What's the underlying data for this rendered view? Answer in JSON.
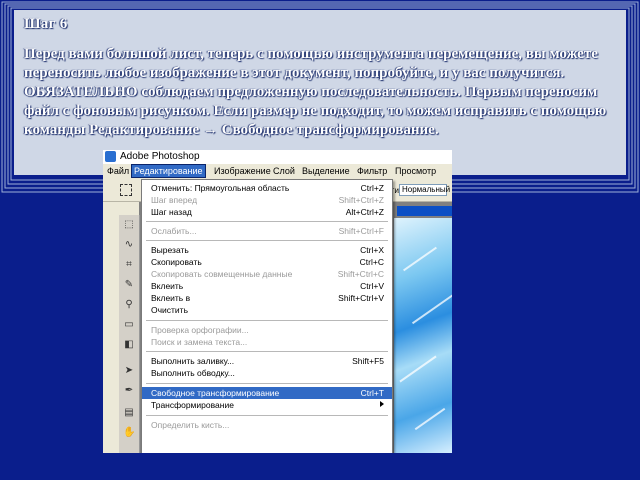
{
  "slide": {
    "title": "Шаг 6",
    "body": "Перед вами большой лист, теперь с помощью инструмента перемещение, вы можете переносить любое изображение в этот документ, попробуйте, и у вас получится. ОБЯЗАТЕЛЬНО соблюдаем предложенную последовательность. Первым переносим файл с фоновым рисунком. Если размер не подходит, то можем исправить с помощью команды Редактирование → Свободное трансформирование."
  },
  "app": {
    "window_title": "Adobe Photoshop",
    "menus": [
      "Файл",
      "Редактирование",
      "Изображение",
      "Слой",
      "Выделение",
      "Фильтр",
      "Просмотр"
    ],
    "active_menu": "Редактирование",
    "options_bar": {
      "mode_label": "Стиль:",
      "mode_value": "Нормальный"
    }
  },
  "edit_menu": {
    "items": [
      {
        "label": "Отменить: Прямоугольная область",
        "shortcut": "Ctrl+Z",
        "state": "enabled"
      },
      {
        "label": "Шаг вперед",
        "shortcut": "Shift+Ctrl+Z",
        "state": "disabled"
      },
      {
        "label": "Шаг назад",
        "shortcut": "Alt+Ctrl+Z",
        "state": "enabled"
      },
      {
        "label": "Ослабить...",
        "shortcut": "Shift+Ctrl+F",
        "state": "disabled"
      },
      {
        "label": "Вырезать",
        "shortcut": "Ctrl+X",
        "state": "enabled"
      },
      {
        "label": "Скопировать",
        "shortcut": "Ctrl+C",
        "state": "enabled"
      },
      {
        "label": "Скопировать совмещенные данные",
        "shortcut": "Shift+Ctrl+C",
        "state": "disabled"
      },
      {
        "label": "Вклеить",
        "shortcut": "Ctrl+V",
        "state": "enabled"
      },
      {
        "label": "Вклеить в",
        "shortcut": "Shift+Ctrl+V",
        "state": "enabled"
      },
      {
        "label": "Очистить",
        "shortcut": "",
        "state": "enabled"
      },
      {
        "label": "Проверка орфографии...",
        "shortcut": "",
        "state": "disabled"
      },
      {
        "label": "Поиск и замена текста...",
        "shortcut": "",
        "state": "disabled"
      },
      {
        "label": "Выполнить заливку...",
        "shortcut": "Shift+F5",
        "state": "enabled"
      },
      {
        "label": "Выполнить обводку...",
        "shortcut": "",
        "state": "enabled"
      },
      {
        "label": "Свободное трансформирование",
        "shortcut": "Ctrl+T",
        "state": "highlighted"
      },
      {
        "label": "Трансформирование",
        "shortcut": "",
        "state": "enabled",
        "submenu": true
      },
      {
        "label": "Определить кисть...",
        "shortcut": "",
        "state": "disabled"
      }
    ]
  },
  "colors": {
    "slide_bg": "#0a1e8c",
    "text_panel": "#cfd7e6",
    "menu_highlight": "#316ac5"
  }
}
